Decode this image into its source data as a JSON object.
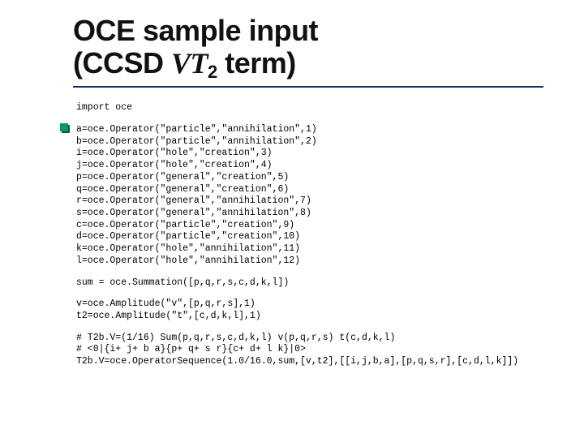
{
  "title": {
    "line1": "OCE sample input",
    "line2_a": "(CCSD ",
    "line2_vt": "VT",
    "line2_sub": "2",
    "line2_b": " term)"
  },
  "code": {
    "import": "import oce",
    "ops": "a=oce.Operator(\"particle\",\"annihilation\",1)\nb=oce.Operator(\"particle\",\"annihilation\",2)\ni=oce.Operator(\"hole\",\"creation\",3)\nj=oce.Operator(\"hole\",\"creation\",4)\np=oce.Operator(\"general\",\"creation\",5)\nq=oce.Operator(\"general\",\"creation\",6)\nr=oce.Operator(\"general\",\"annihilation\",7)\ns=oce.Operator(\"general\",\"annihilation\",8)\nc=oce.Operator(\"particle\",\"creation\",9)\nd=oce.Operator(\"particle\",\"creation\",10)\nk=oce.Operator(\"hole\",\"annihilation\",11)\nl=oce.Operator(\"hole\",\"annihilation\",12)",
    "sum": "sum = oce.Summation([p,q,r,s,c,d,k,l])",
    "amp": "v=oce.Amplitude(\"v\",[p,q,r,s],1)\nt2=oce.Amplitude(\"t\",[c,d,k,l],1)",
    "seq": "# T2b.V=(1/16) Sum(p,q,r,s,c,d,k,l) v(p,q,r,s) t(c,d,k,l)\n# <0|{i+ j+ b a}{p+ q+ s r}{c+ d+ l k}|0>\nT2b.V=oce.OperatorSequence(1.0/16.0,sum,[v,t2],[[i,j,b,a],[p,q,s,r],[c,d,l,k]])"
  }
}
